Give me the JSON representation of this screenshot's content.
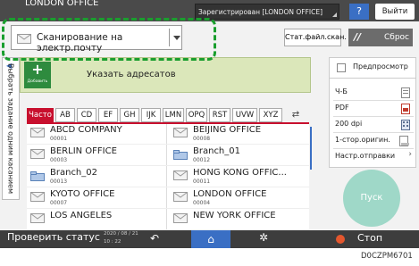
{
  "top_bar": {
    "office_title": "LONDON OFFICE",
    "status_text": "Зарегистрирован [LONDON OFFICE]",
    "help_label": "?",
    "logout_label": "Выйти"
  },
  "mode_selector": {
    "value": "Сканирование на электр.почту"
  },
  "header_buttons": {
    "stored_files_label": "Стат.файл.скан.",
    "reset_label": "Сброс"
  },
  "side_tab": {
    "label": "Выбрать задание одним касанием"
  },
  "add_panel": {
    "add_button_label": "Добавить",
    "prompt_text": "Указать адресатов"
  },
  "tabs": [
    "Часто",
    "AB",
    "CD",
    "EF",
    "GH",
    "IJK",
    "LMN",
    "OPQ",
    "RST",
    "UVW",
    "XYZ"
  ],
  "active_tab": "Часто",
  "destinations": [
    {
      "name": "ABCD COMPANY",
      "number": "00001",
      "icon": "envelope-icon"
    },
    {
      "name": "BEIJING OFFICE",
      "number": "00008",
      "icon": "envelope-icon"
    },
    {
      "name": "BERLIN OFFICE",
      "number": "00003",
      "icon": "envelope-icon"
    },
    {
      "name": "Branch_01",
      "number": "00012",
      "icon": "folder-icon"
    },
    {
      "name": "Branch_02",
      "number": "00013",
      "icon": "folder-icon"
    },
    {
      "name": "HONG KONG OFFIC...",
      "number": "00011",
      "icon": "envelope-icon"
    },
    {
      "name": "KYOTO OFFICE",
      "number": "00007",
      "icon": "envelope-icon"
    },
    {
      "name": "LONDON OFFICE",
      "number": "00004",
      "icon": "envelope-icon"
    },
    {
      "name": "LOS ANGELES",
      "number": "",
      "icon": "envelope-icon"
    },
    {
      "name": "NEW YORK OFFICE",
      "number": "",
      "icon": "envelope-icon"
    }
  ],
  "options_panel": {
    "preview_label": "Предпросмотр",
    "items": [
      {
        "label": "Ч-Б",
        "icon": "bw-doc-icon"
      },
      {
        "label": "PDF",
        "icon": "pdf-icon"
      },
      {
        "label": "200 dpi",
        "icon": "resolution-icon"
      },
      {
        "label": "1-стор.оригин.",
        "icon": "one-sided-icon"
      },
      {
        "label": "Настр.отправки",
        "icon": "chevron-right-icon"
      }
    ]
  },
  "start_button": {
    "label": "Пуск"
  },
  "bottom_bar": {
    "check_status_label": "Проверить статус",
    "date": "2020 / 08 / 21",
    "time": "10 : 22",
    "stop_label": "Стоп"
  },
  "figure_code": "D0CZPM6701",
  "colors": {
    "accent_red": "#c8102e",
    "highlight_green": "#1a9e2e",
    "home_blue": "#3a6fc4",
    "add_green": "#2e8b3e",
    "start_teal": "#9fd8c8",
    "stop_orange": "#e4572e"
  }
}
